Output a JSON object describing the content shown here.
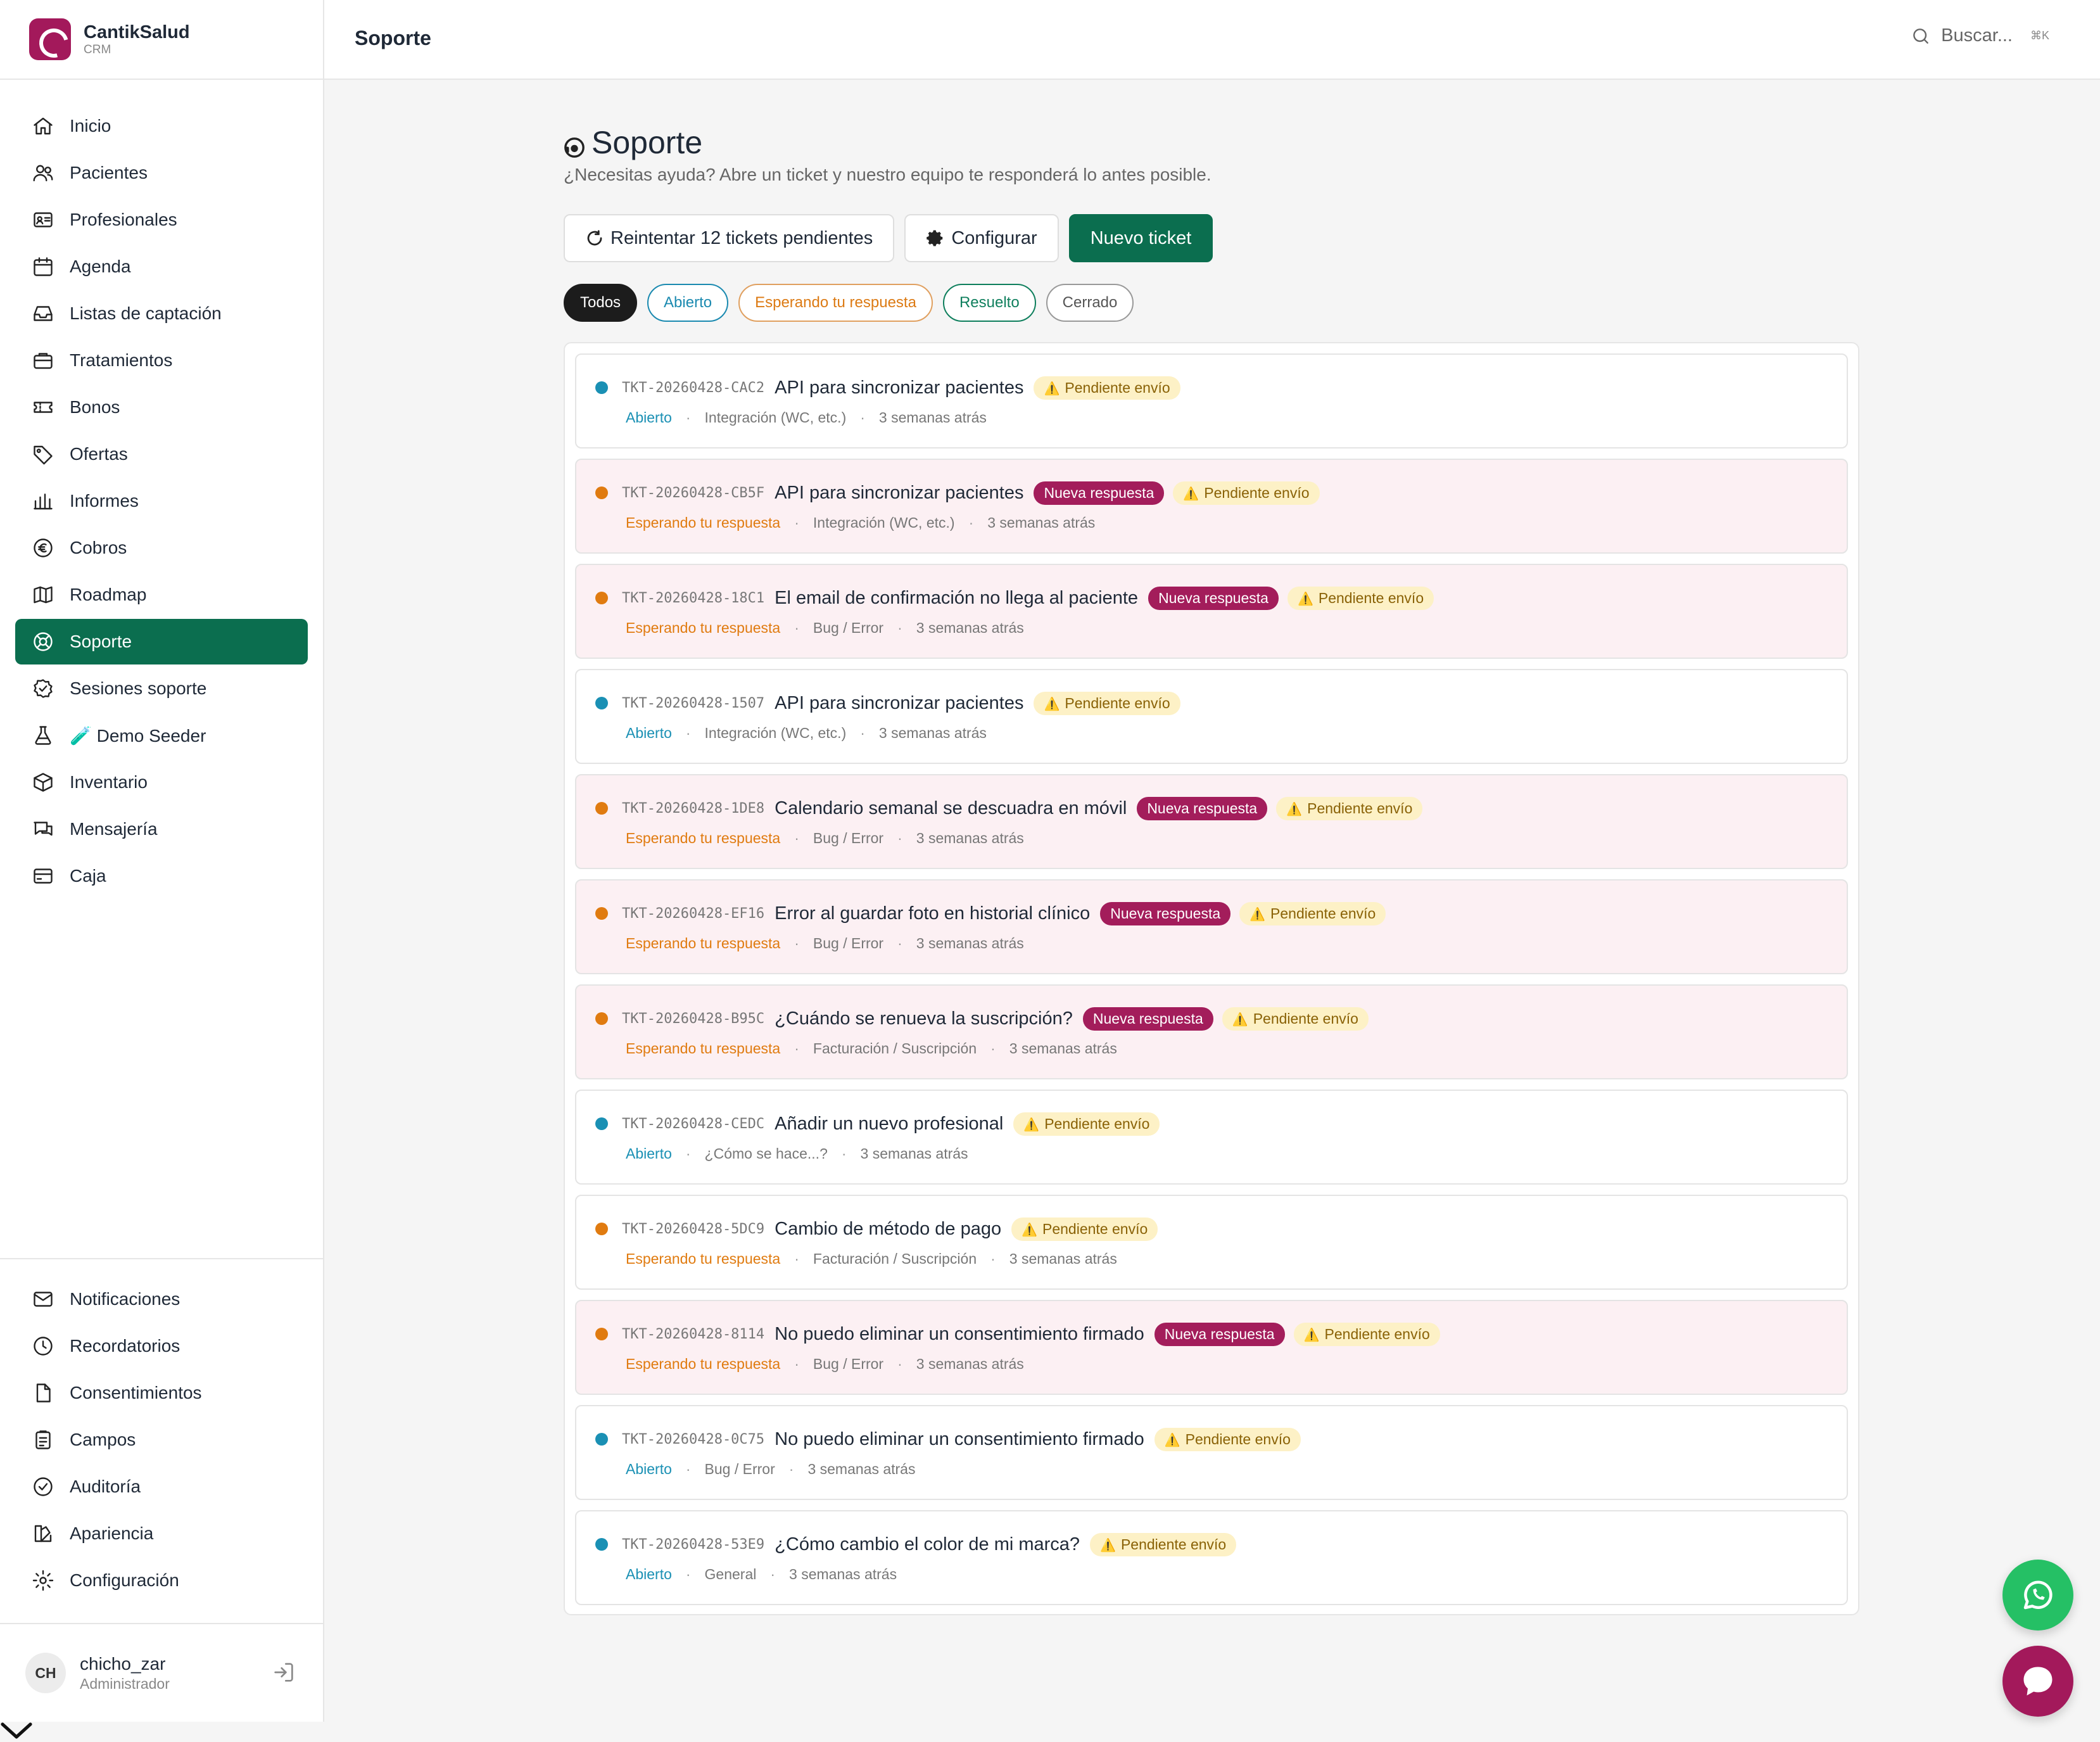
{
  "brand": {
    "name": "CantikSalud",
    "sub": "CRM"
  },
  "topbar": {
    "title": "Soporte",
    "search_placeholder": "Buscar...",
    "shortcut": "⌘K"
  },
  "sidebar": {
    "items": [
      {
        "label": "Inicio",
        "icon": "home-icon"
      },
      {
        "label": "Pacientes",
        "icon": "users-icon"
      },
      {
        "label": "Profesionales",
        "icon": "id-card-icon"
      },
      {
        "label": "Agenda",
        "icon": "calendar-icon"
      },
      {
        "label": "Listas de captación",
        "icon": "inbox-icon"
      },
      {
        "label": "Tratamientos",
        "icon": "briefcase-icon"
      },
      {
        "label": "Bonos",
        "icon": "ticket-icon"
      },
      {
        "label": "Ofertas",
        "icon": "tag-icon"
      },
      {
        "label": "Informes",
        "icon": "bar-chart-icon"
      },
      {
        "label": "Cobros",
        "icon": "euro-icon"
      },
      {
        "label": "Roadmap",
        "icon": "map-icon"
      },
      {
        "label": "Soporte",
        "icon": "lifebuoy-icon",
        "active": true
      },
      {
        "label": "Sesiones soporte",
        "icon": "check-badge-icon"
      },
      {
        "label": "🧪 Demo Seeder",
        "icon": "flask-icon"
      },
      {
        "label": "Inventario",
        "icon": "box-icon"
      },
      {
        "label": "Mensajería",
        "icon": "messages-icon"
      },
      {
        "label": "Caja",
        "icon": "credit-card-icon"
      }
    ],
    "bottom_items": [
      {
        "label": "Notificaciones",
        "icon": "mail-icon"
      },
      {
        "label": "Recordatorios",
        "icon": "clock-icon"
      },
      {
        "label": "Consentimientos",
        "icon": "file-icon"
      },
      {
        "label": "Campos",
        "icon": "clipboard-icon"
      },
      {
        "label": "Auditoría",
        "icon": "check-circle-icon"
      },
      {
        "label": "Apariencia",
        "icon": "palette-icon"
      },
      {
        "label": "Configuración",
        "icon": "gear-icon"
      }
    ],
    "user": {
      "initials": "CH",
      "name": "chicho_zar",
      "role": "Administrador"
    }
  },
  "page": {
    "title": "Soporte",
    "subtitle": "¿Necesitas ayuda? Abre un ticket y nuestro equipo te responderá lo antes posible.",
    "actions": {
      "retry": "Reintentar 12 tickets pendientes",
      "configure": "Configurar",
      "new_ticket": "Nuevo ticket"
    },
    "filters": [
      "Todos",
      "Abierto",
      "Esperando tu respuesta",
      "Resuelto",
      "Cerrado"
    ]
  },
  "labels": {
    "new_reply": "Nueva respuesta",
    "pending_send": "Pendiente envío",
    "warn_glyph": "⚠️"
  },
  "tickets": [
    {
      "code": "TKT-20260428-CAC2",
      "title": "API para sincronizar pacientes",
      "status": "Abierto",
      "category": "Integración (WC, etc.)",
      "time": "3 semanas atrás",
      "new_reply": false
    },
    {
      "code": "TKT-20260428-CB5F",
      "title": "API para sincronizar pacientes",
      "status": "Esperando tu respuesta",
      "category": "Integración (WC, etc.)",
      "time": "3 semanas atrás",
      "new_reply": true
    },
    {
      "code": "TKT-20260428-18C1",
      "title": "El email de confirmación no llega al paciente",
      "status": "Esperando tu respuesta",
      "category": "Bug / Error",
      "time": "3 semanas atrás",
      "new_reply": true
    },
    {
      "code": "TKT-20260428-1507",
      "title": "API para sincronizar pacientes",
      "status": "Abierto",
      "category": "Integración (WC, etc.)",
      "time": "3 semanas atrás",
      "new_reply": false
    },
    {
      "code": "TKT-20260428-1DE8",
      "title": "Calendario semanal se descuadra en móvil",
      "status": "Esperando tu respuesta",
      "category": "Bug / Error",
      "time": "3 semanas atrás",
      "new_reply": true
    },
    {
      "code": "TKT-20260428-EF16",
      "title": "Error al guardar foto en historial clínico",
      "status": "Esperando tu respuesta",
      "category": "Bug / Error",
      "time": "3 semanas atrás",
      "new_reply": true
    },
    {
      "code": "TKT-20260428-B95C",
      "title": "¿Cuándo se renueva la suscripción?",
      "status": "Esperando tu respuesta",
      "category": "Facturación / Suscripción",
      "time": "3 semanas atrás",
      "new_reply": true
    },
    {
      "code": "TKT-20260428-CEDC",
      "title": "Añadir un nuevo profesional",
      "status": "Abierto",
      "category": "¿Cómo se hace...?",
      "time": "3 semanas atrás",
      "new_reply": false
    },
    {
      "code": "TKT-20260428-5DC9",
      "title": "Cambio de método de pago",
      "status": "Esperando tu respuesta",
      "category": "Facturación / Suscripción",
      "time": "3 semanas atrás",
      "new_reply": false
    },
    {
      "code": "TKT-20260428-8114",
      "title": "No puedo eliminar un consentimiento firmado",
      "status": "Esperando tu respuesta",
      "category": "Bug / Error",
      "time": "3 semanas atrás",
      "new_reply": true
    },
    {
      "code": "TKT-20260428-0C75",
      "title": "No puedo eliminar un consentimiento firmado",
      "status": "Abierto",
      "category": "Bug / Error",
      "time": "3 semanas atrás",
      "new_reply": false
    },
    {
      "code": "TKT-20260428-53E9",
      "title": "¿Cómo cambio el color de mi marca?",
      "status": "Abierto",
      "category": "General",
      "time": "3 semanas atrás",
      "new_reply": false
    }
  ],
  "colors": {
    "accent": "#0b6e4f",
    "brand": "#a3195b",
    "open": "#1a90b4",
    "waiting": "#e07b10",
    "whatsapp": "#25c065"
  }
}
